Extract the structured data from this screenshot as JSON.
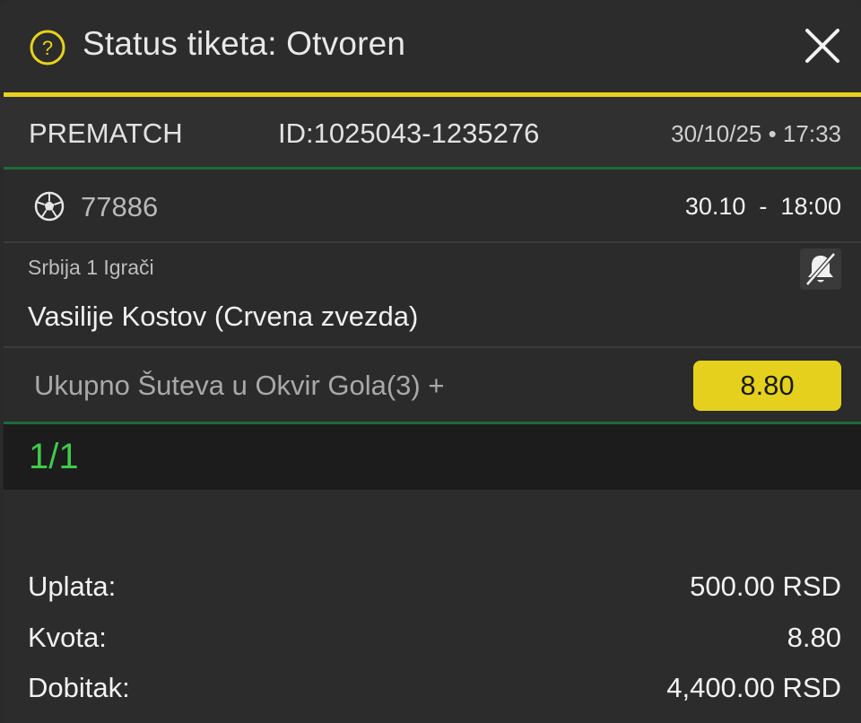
{
  "header": {
    "title": "Status tiketa: Otvoren",
    "help_icon": "help-circle-icon",
    "close_icon": "close-icon",
    "accent": "#e8d21e"
  },
  "ticket": {
    "type": "PREMATCH",
    "id": "ID:1025043-1235276",
    "datetime": "30/10/25 • 17:33"
  },
  "event": {
    "sport_icon": "soccer-ball-icon",
    "code": "77886",
    "date": "30.10",
    "separator": "-",
    "time": "18:00",
    "league": "Srbija 1 Igrači",
    "player": "Vasilije Kostov (Crvena zvezda)",
    "notification_icon": "bell-off-icon"
  },
  "selection": {
    "market": "Ukupno Šuteva u Okvir Gola(3)  +",
    "odd": "8.80"
  },
  "summary": {
    "count": "1/1",
    "count_color": "#3fcb4b",
    "rows": [
      {
        "label": "Uplata:",
        "value": "500.00 RSD"
      },
      {
        "label": "Kvota:",
        "value": "8.80"
      },
      {
        "label": "Dobitak:",
        "value": "4,400.00 RSD"
      }
    ]
  }
}
